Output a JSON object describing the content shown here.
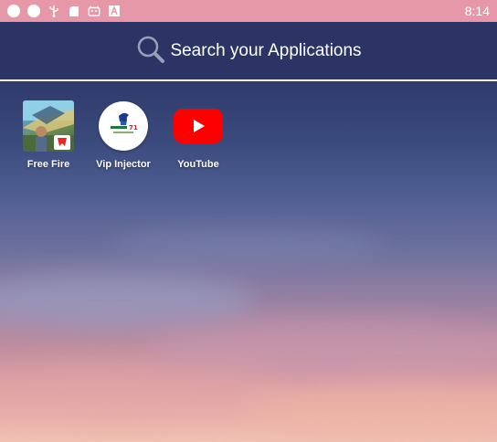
{
  "status_bar": {
    "time": "8:14",
    "icons": [
      "circle-icon",
      "circle-icon",
      "usb-icon",
      "sd-card-icon",
      "android-icon",
      "a-box-icon"
    ]
  },
  "search": {
    "placeholder": "Search your Applications"
  },
  "apps": [
    {
      "label": "Free Fire",
      "icon": "free-fire-icon"
    },
    {
      "label": "Vip Injector",
      "icon": "vip-injector-icon",
      "icon_text": "71"
    },
    {
      "label": "YouTube",
      "icon": "youtube-icon"
    }
  ],
  "colors": {
    "status_bar": "#e798a8",
    "search_bar": "#2b3465",
    "youtube_red": "#ff0000"
  }
}
